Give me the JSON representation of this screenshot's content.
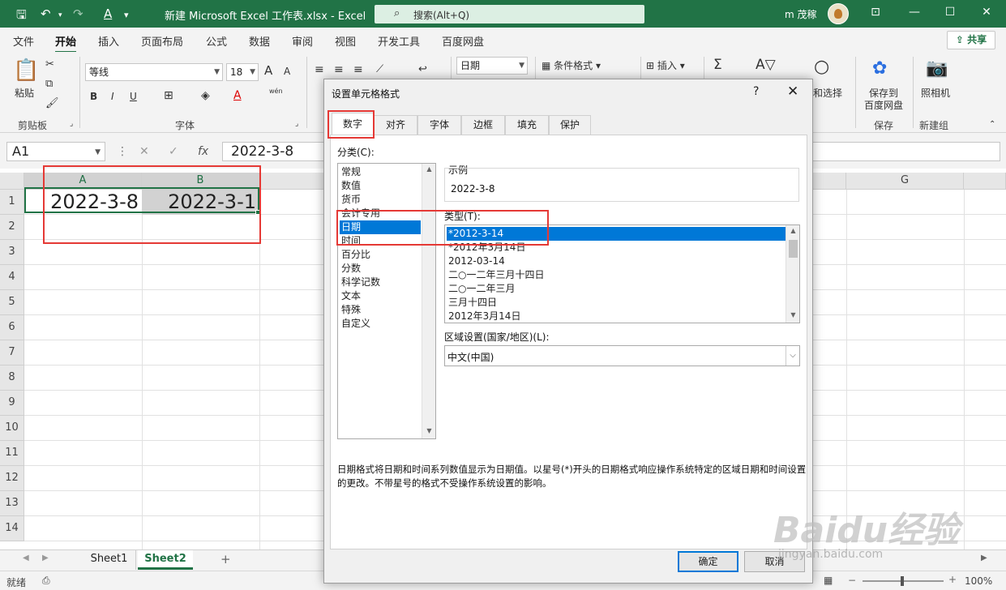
{
  "titlebar": {
    "title": "新建 Microsoft Excel 工作表.xlsx  -  Excel",
    "search": "搜索(Alt+Q)",
    "user": "m 茂稼",
    "save_icon": "save-icon",
    "undo_icon": "undo-icon",
    "redo_icon": "redo-icon",
    "font_color_icon": "A"
  },
  "menu": {
    "tabs": [
      "文件",
      "开始",
      "插入",
      "页面布局",
      "公式",
      "数据",
      "审阅",
      "视图",
      "开发工具",
      "百度网盘"
    ],
    "share": "共享"
  },
  "ribbon": {
    "clipboard": {
      "paste": "粘贴",
      "group": "剪贴板"
    },
    "font": {
      "name": "等线",
      "size": "18",
      "group": "字体",
      "bold": "B",
      "italic": "I",
      "underline": "U",
      "grow": "A",
      "shrink": "A",
      "wen": "wén"
    },
    "number": {
      "format": "日期"
    },
    "styles": {
      "conditional": "条件格式"
    },
    "cells": {
      "insert": "插入"
    },
    "editing": {
      "find_select": "查找和选择"
    },
    "save": {
      "label_line1": "保存到",
      "label_line2": "百度网盘",
      "group": "保存"
    },
    "camera": {
      "label": "照相机",
      "group": "新建组"
    }
  },
  "formula_bar": {
    "name_box": "A1",
    "cancel": "✕",
    "enter": "✓",
    "fx": "fx",
    "value": "2022-3-8"
  },
  "grid": {
    "columns": [
      "A",
      "B",
      "G"
    ],
    "rows": [
      "1",
      "2",
      "3",
      "4",
      "5",
      "6",
      "7",
      "8",
      "9",
      "10",
      "11",
      "12",
      "13",
      "14"
    ],
    "cells": {
      "A1": "2022-3-8",
      "B1": "2022-3-1"
    }
  },
  "sheets": {
    "tabs": [
      "Sheet1",
      "Sheet2"
    ],
    "active": "Sheet2",
    "add": "+"
  },
  "status": {
    "ready": "就绪",
    "zoom": "100%"
  },
  "dialog": {
    "title": "设置单元格格式",
    "help": "?",
    "close": "✕",
    "tabs": [
      "数字",
      "对齐",
      "字体",
      "边框",
      "填充",
      "保护"
    ],
    "category_label": "分类(C):",
    "categories": [
      "常规",
      "数值",
      "货币",
      "会计专用",
      "日期",
      "时间",
      "百分比",
      "分数",
      "科学记数",
      "文本",
      "特殊",
      "自定义"
    ],
    "selected_category": "日期",
    "sample_label": "示例",
    "sample_value": "2022-3-8",
    "type_label": "类型(T):",
    "types": [
      "*2012-3-14",
      "*2012年3月14日",
      "2012-03-14",
      "二○一二年三月十四日",
      "二○一二年三月",
      "三月十四日",
      "2012年3月14日"
    ],
    "selected_type": "*2012-3-14",
    "locale_label": "区域设置(国家/地区)(L):",
    "locale_value": "中文(中国)",
    "description": "日期格式将日期和时间系列数值显示为日期值。以星号(*)开头的日期格式响应操作系统特定的区域日期和时间设置的更改。不带星号的格式不受操作系统设置的影响。",
    "ok": "确定",
    "cancel": "取消"
  },
  "watermark": {
    "brand": "Baidu经验",
    "url": "jingyan.baidu.com"
  },
  "colors": {
    "excel_green": "#217346",
    "highlight_red": "#e53935",
    "selection_blue": "#0078d7"
  }
}
